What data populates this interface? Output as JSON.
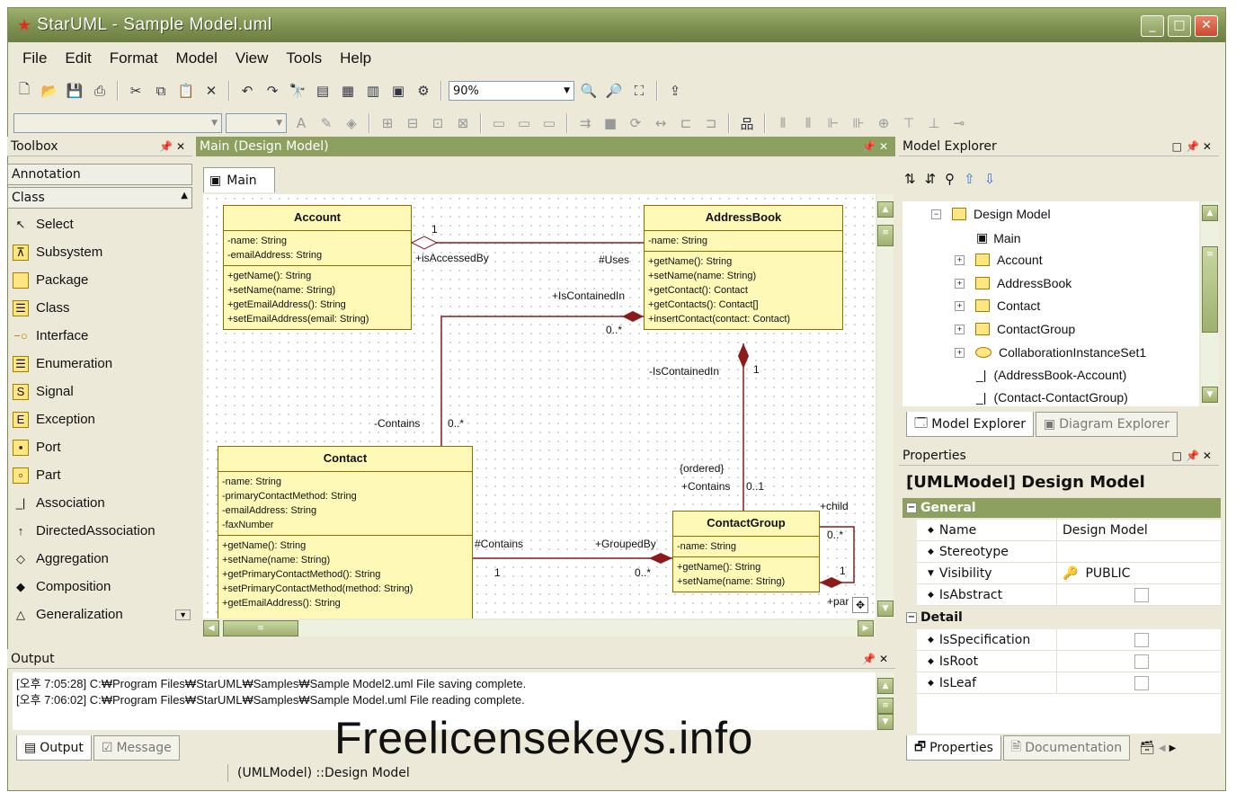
{
  "window": {
    "title": "StarUML - Sample Model.uml"
  },
  "menu": [
    "File",
    "Edit",
    "Format",
    "Model",
    "View",
    "Tools",
    "Help"
  ],
  "toolbar": {
    "zoom": "90%"
  },
  "toolbox": {
    "title": "Toolbox",
    "categories": [
      "Annotation",
      "Class"
    ],
    "items": [
      {
        "label": "Select",
        "icon": "arrow-pointer-icon"
      },
      {
        "label": "Subsystem",
        "icon": "subsystem-icon"
      },
      {
        "label": "Package",
        "icon": "folder-icon"
      },
      {
        "label": "Class",
        "icon": "class-icon"
      },
      {
        "label": "Interface",
        "icon": "interface-icon"
      },
      {
        "label": "Enumeration",
        "icon": "enumeration-icon"
      },
      {
        "label": "Signal",
        "icon": "signal-icon"
      },
      {
        "label": "Exception",
        "icon": "exception-icon"
      },
      {
        "label": "Port",
        "icon": "port-icon"
      },
      {
        "label": "Part",
        "icon": "part-icon"
      },
      {
        "label": "Association",
        "icon": "association-icon"
      },
      {
        "label": "DirectedAssociation",
        "icon": "directed-association-icon"
      },
      {
        "label": "Aggregation",
        "icon": "aggregation-icon"
      },
      {
        "label": "Composition",
        "icon": "composition-icon"
      },
      {
        "label": "Generalization",
        "icon": "generalization-icon"
      }
    ]
  },
  "editor": {
    "title": "Main (Design Model)",
    "tab": "Main"
  },
  "diagram": {
    "account": {
      "name": "Account",
      "attrs": [
        "-name: String",
        "-emailAddress: String"
      ],
      "ops": [
        "+getName(): String",
        "+setName(name: String)",
        "+getEmailAddress(): String",
        "+setEmailAddress(email: String)"
      ]
    },
    "addressbook": {
      "name": "AddressBook",
      "attrs": [
        "-name: String"
      ],
      "ops": [
        "+getName(): String",
        "+setName(name: String)",
        "+getContact(): Contact",
        "+getContacts(): Contact[]",
        "+insertContact(contact: Contact)"
      ]
    },
    "contact": {
      "name": "Contact",
      "attrs": [
        "-name: String",
        "-primaryContactMethod: String",
        "-emailAddress: String",
        "-faxNumber"
      ],
      "ops": [
        "+getName(): String",
        "+setName(name: String)",
        "+getPrimaryContactMethod(): String",
        "+setPrimaryContactMethod(method: String)",
        "+getEmailAddress(): String"
      ]
    },
    "contactgroup": {
      "name": "ContactGroup",
      "attrs": [
        "-name: String"
      ],
      "ops": [
        "+getName(): String",
        "+setName(name: String)"
      ]
    },
    "labels": {
      "one_a": "1",
      "isAccessedBy": "+isAccessedBy",
      "uses": "#Uses",
      "isContainedIn": "+IsContainedIn",
      "many_a": "0..*",
      "isContainedIn2": "-IsContainedIn",
      "one_b": "1",
      "contains": "-Contains",
      "many_b": "0..*",
      "ordered": "{ordered}",
      "contains2": "+Contains",
      "opt": "0..1",
      "child": "+child",
      "many_c": "0..*",
      "one_c": "1",
      "par": "+par",
      "contains3": "#Contains",
      "groupedBy": "+GroupedBy",
      "one_d": "1",
      "many_d": "0..*"
    }
  },
  "explorer": {
    "title": "Model Explorer",
    "root": "Design Model",
    "nodes": [
      "Main",
      "Account",
      "AddressBook",
      "Contact",
      "ContactGroup",
      "CollaborationInstanceSet1",
      "(AddressBook-Account)",
      "(Contact-ContactGroup)"
    ],
    "tabs": [
      "Model Explorer",
      "Diagram Explorer"
    ]
  },
  "properties": {
    "title": "Properties",
    "header": "[UMLModel] Design Model",
    "general": "General",
    "rows": [
      {
        "k": "Name",
        "v": "Design Model"
      },
      {
        "k": "Stereotype",
        "v": ""
      },
      {
        "k": "Visibility",
        "v": "PUBLIC"
      },
      {
        "k": "IsAbstract",
        "v": ""
      }
    ],
    "detail": "Detail",
    "detail_rows": [
      {
        "k": "IsSpecification"
      },
      {
        "k": "IsRoot"
      },
      {
        "k": "IsLeaf"
      }
    ],
    "tabs": [
      "Properties",
      "Documentation"
    ]
  },
  "output": {
    "title": "Output",
    "lines": [
      "[오후 7:05:28]  C:₩Program Files₩StarUML₩Samples₩Sample Model2.uml File saving complete.",
      "[오후 7:06:02]  C:₩Program Files₩StarUML₩Samples₩Sample Model.uml File reading complete."
    ],
    "tabs": [
      "Output",
      "Message"
    ]
  },
  "status": {
    "text": "(UMLModel) ::Design Model"
  },
  "watermark": "Freelicensekeys.info"
}
